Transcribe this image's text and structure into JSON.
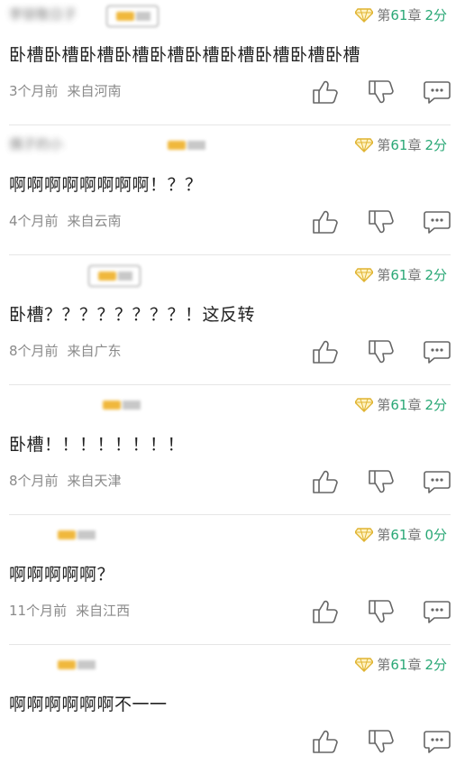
{
  "comments": [
    {
      "username": "李锁敬日子",
      "badge": "outlined",
      "chapter_prefix": "第",
      "chapter_num": "61",
      "chapter_suffix": "章",
      "score": "2分",
      "text": "卧槽卧槽卧槽卧槽卧槽卧槽卧槽卧槽卧槽卧槽",
      "time": "3个月前",
      "location": "来自河南"
    },
    {
      "username": "偶子的小",
      "badge": "plain",
      "chapter_prefix": "第",
      "chapter_num": "61",
      "chapter_suffix": "章",
      "score": "2分",
      "text": "啊啊啊啊啊啊啊啊！？？",
      "time": "4个月前",
      "location": "来自云南"
    },
    {
      "username": "",
      "badge": "outlined",
      "chapter_prefix": "第",
      "chapter_num": "61",
      "chapter_suffix": "章",
      "score": "2分",
      "text": "卧槽？？？？？？？？！这反转",
      "time": "8个月前",
      "location": "来自广东"
    },
    {
      "username": "",
      "badge": "plain",
      "chapter_prefix": "第",
      "chapter_num": "61",
      "chapter_suffix": "章",
      "score": "2分",
      "text": "卧槽！！！！！！！！",
      "time": "8个月前",
      "location": "来自天津"
    },
    {
      "username": "",
      "badge": "plain",
      "chapter_prefix": "第",
      "chapter_num": "61",
      "chapter_suffix": "章",
      "score": "0分",
      "text": "啊啊啊啊啊？",
      "time": "11个月前",
      "location": "来自江西"
    },
    {
      "username": "",
      "badge": "plain",
      "chapter_prefix": "第",
      "chapter_num": "61",
      "chapter_suffix": "章",
      "score": "2分",
      "text": "啊啊啊啊啊啊不一一",
      "time": "",
      "location": ""
    }
  ],
  "colors": {
    "accent": "#2aa876",
    "meta": "#777777",
    "badge_gold": "#f0b83c",
    "divider": "#e6e6e6"
  },
  "icons": {
    "chapter": "diamond-gem-icon",
    "like": "thumbs-up-icon",
    "dislike": "thumbs-down-icon",
    "reply": "comment-bubble-icon"
  }
}
